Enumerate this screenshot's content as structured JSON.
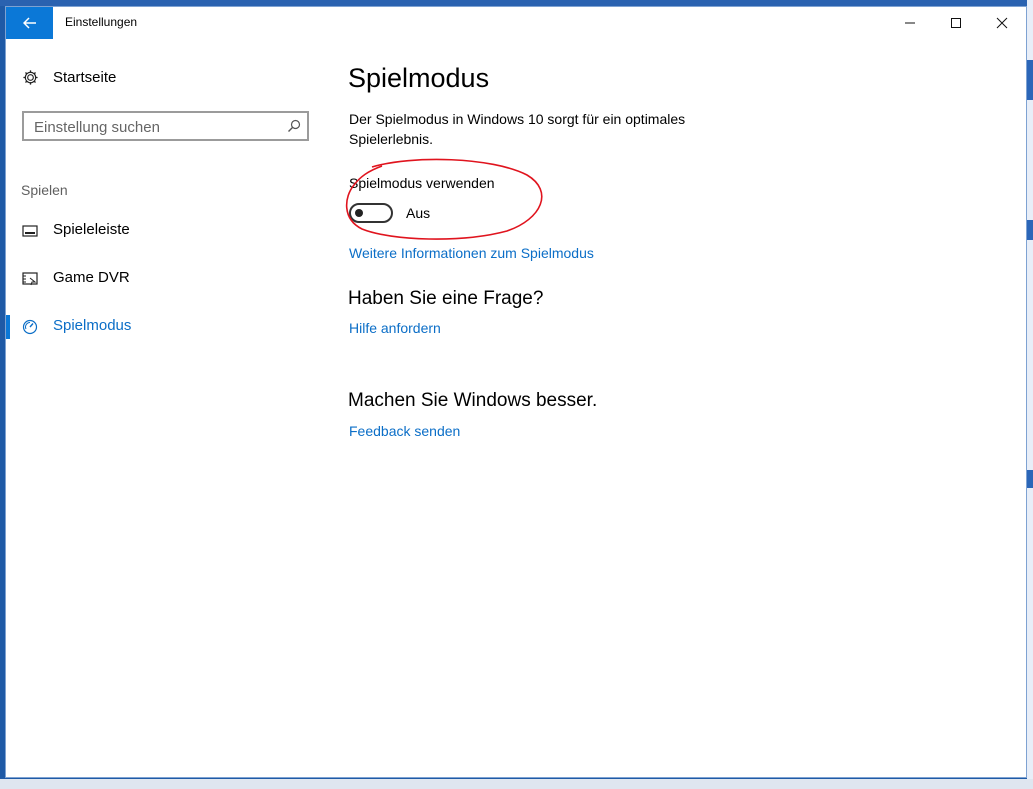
{
  "window": {
    "title": "Einstellungen",
    "accent": "#0b78d7"
  },
  "sidebar": {
    "home_label": "Startseite",
    "search_placeholder": "Einstellung suchen",
    "section_label": "Spielen",
    "items": [
      {
        "label": "Spieleleiste",
        "icon": "gamebar-icon"
      },
      {
        "label": "Game DVR",
        "icon": "game-dvr-icon"
      },
      {
        "label": "Spielmodus",
        "icon": "gamemode-icon",
        "active": true
      }
    ]
  },
  "main": {
    "title": "Spielmodus",
    "description": "Der Spielmodus in Windows 10 sorgt für ein optimales Spielerlebnis.",
    "toggle": {
      "label": "Spielmodus verwenden",
      "state": "Aus",
      "on": false
    },
    "info_link": "Weitere Informationen zum Spielmodus",
    "question_heading": "Haben Sie eine Frage?",
    "help_link": "Hilfe anfordern",
    "feedback_heading": "Machen Sie Windows besser.",
    "feedback_link": "Feedback senden"
  },
  "annotation": {
    "color": "#e0141e"
  }
}
